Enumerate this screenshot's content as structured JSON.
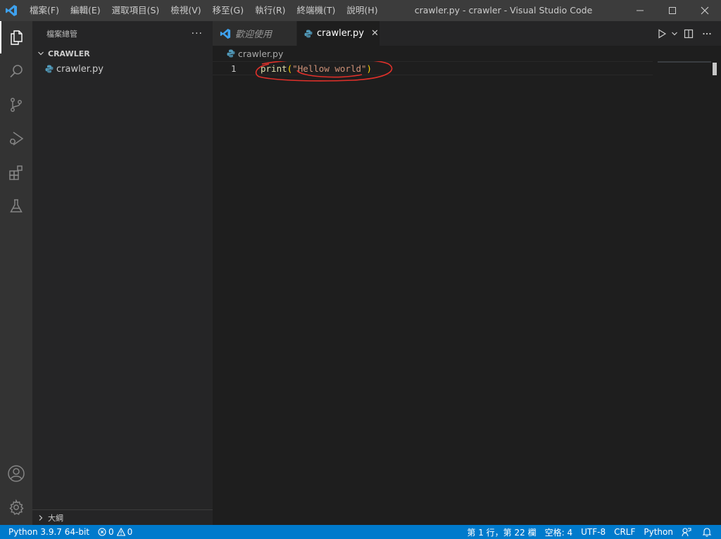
{
  "titlebar": {
    "menu": [
      "檔案(F)",
      "編輯(E)",
      "選取項目(S)",
      "檢視(V)",
      "移至(G)",
      "執行(R)",
      "終端機(T)",
      "說明(H)"
    ],
    "title": "crawler.py - crawler - Visual Studio Code"
  },
  "activitybar": {
    "icons": [
      "explorer-icon",
      "search-icon",
      "source-control-icon",
      "run-debug-icon",
      "extensions-icon",
      "testing-icon",
      "account-icon",
      "settings-gear-icon"
    ]
  },
  "sidebar": {
    "header": "檔案總管",
    "more": "···",
    "folder": "CRAWLER",
    "files": [
      {
        "name": "crawler.py",
        "icon": "python-icon"
      }
    ],
    "outline": "大綱"
  },
  "tabs": [
    {
      "label": "歡迎使用",
      "active": false,
      "icon": "vscode-icon"
    },
    {
      "label": "crawler.py",
      "active": true,
      "icon": "python-icon",
      "close": "✕"
    }
  ],
  "breadcrumb": {
    "file": "crawler.py"
  },
  "editor": {
    "lines": [
      {
        "number": "1",
        "fn": "print",
        "open": "(",
        "string": "\"Hellow world\"",
        "close": ")"
      }
    ]
  },
  "statusbar": {
    "interpreter": "Python 3.9.7 64-bit",
    "errors": "0",
    "warnings": "0",
    "position": "第 1 行，第 22 欄",
    "indent": "空格: 4",
    "encoding": "UTF-8",
    "eol": "CRLF",
    "language": "Python"
  },
  "colors": {
    "accent": "#007acc",
    "annotation": "#e0302a"
  }
}
